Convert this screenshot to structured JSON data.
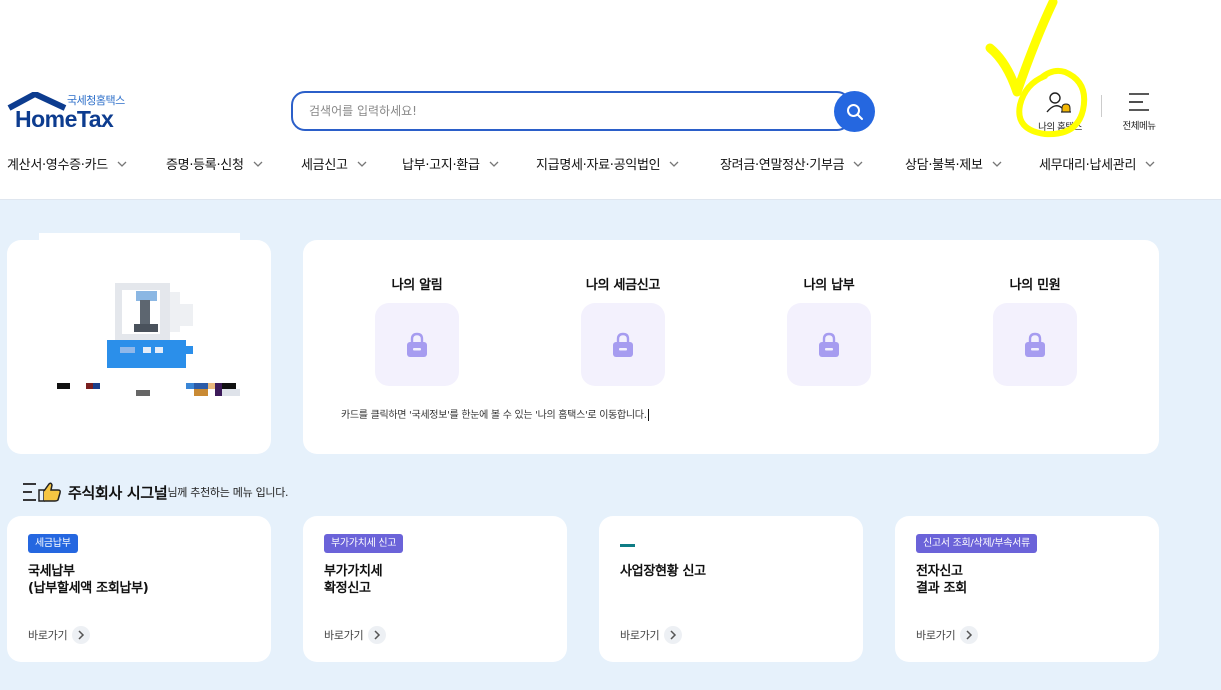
{
  "header": {
    "logo_sub": "국세청홈택스",
    "logo_main": "HomeTax",
    "search_placeholder": "검색어를 입력하세요!",
    "my_hometax_label": "나의 홈택스",
    "all_menu_label": "전체메뉴"
  },
  "nav": {
    "items": [
      "계산서·영수증·카드",
      "증명·등록·신청",
      "세금신고",
      "납부·고지·환급",
      "지급명세·자료·공익법인",
      "장려금·연말정산·기부금",
      "상담·불복·제보",
      "세무대리·납세관리"
    ]
  },
  "summary": {
    "items": [
      "나의 알림",
      "나의 세금신고",
      "나의 납부",
      "나의 민원"
    ],
    "note": "카드를 클릭하면 '국세정보'를 한눈에 볼 수 있는 '나의 홈택스'로 이동합니다."
  },
  "recommend": {
    "company": "주식회사 시그널",
    "suffix": "님께 추천하는 메뉴 입니다.",
    "cards": [
      {
        "badge": "세금납부",
        "title": "국세납부\n(납부할세액 조회납부)",
        "go": "바로가기",
        "badge_color": "#2567e0"
      },
      {
        "badge": "부가가치세 신고",
        "title": "부가가치세\n확정신고",
        "go": "바로가기",
        "badge_color": "#6b63d9"
      },
      {
        "badge": "",
        "title": "사업장현황 신고",
        "go": "바로가기",
        "badge_color": "#0f7c85"
      },
      {
        "badge": "신고서 조회/삭제/부속서류",
        "title": "전자신고\n결과 조회",
        "go": "바로가기",
        "badge_color": "#6b63d9"
      }
    ]
  },
  "colors": {
    "primary": "#2567e0",
    "background": "#e6f1fb",
    "annotation": "#ffff00"
  }
}
